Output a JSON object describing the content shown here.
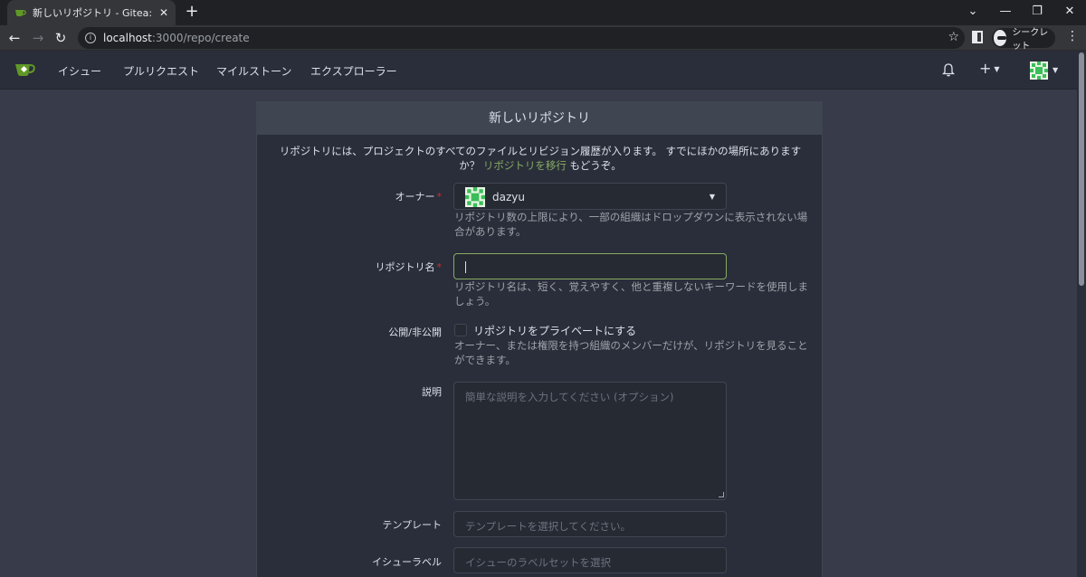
{
  "browser": {
    "tab_title": "新しいリポジトリ - Gitea: Git with a",
    "tab_close": "✕",
    "new_tab": "+",
    "url_host": "localhost",
    "url_path": ":3000/repo/create",
    "incognito_label": "シークレット",
    "window_controls": [
      "⌄",
      "—",
      "❐",
      "✕"
    ]
  },
  "navbar": {
    "items": [
      "イシュー",
      "プルリクエスト",
      "マイルストーン",
      "エクスプローラー"
    ],
    "plus_label": "+"
  },
  "form": {
    "title": "新しいリポジトリ",
    "intro_text": "リポジトリには、プロジェクトのすべてのファイルとリビジョン履歴が入ります。 すでにほかの場所にありますか？ ",
    "intro_link": "リポジトリを移行",
    "intro_suffix": " もどうぞ。",
    "owner": {
      "label": "オーナー",
      "value": "dazyu",
      "hint": "リポジトリ数の上限により、一部の組織はドロップダウンに表示されない場合があります。"
    },
    "repo_name": {
      "label": "リポジトリ名",
      "value": "",
      "hint": "リポジトリ名は、短く、覚えやすく、他と重複しないキーワードを使用しましょう。"
    },
    "visibility": {
      "label": "公開/非公開",
      "checkbox_label": "リポジトリをプライベートにする",
      "checked": false,
      "hint": "オーナー、または権限を持つ組織のメンバーだけが、リポジトリを見ることができます。"
    },
    "description": {
      "label": "説明",
      "placeholder": "簡単な説明を入力してください (オプション)"
    },
    "template": {
      "label": "テンプレート",
      "placeholder": "テンプレートを選択してください。"
    },
    "issue_labels": {
      "label": "イシューラベル",
      "placeholder": "イシューのラベルセットを選択"
    }
  },
  "colors": {
    "accent": "#87ab63",
    "required": "#db2828",
    "background": "#383c4a",
    "panel": "#2a2e3a"
  },
  "icons": [
    "gitea-logo-icon",
    "bell-icon",
    "plus-icon",
    "avatar-identicon",
    "info-icon",
    "star-icon",
    "side-panel-icon",
    "incognito-icon"
  ]
}
